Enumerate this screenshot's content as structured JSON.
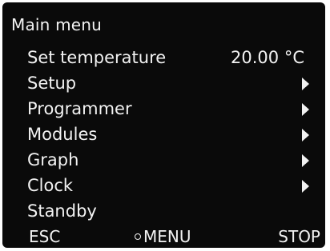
{
  "title": "Main menu",
  "menu": {
    "items": [
      {
        "label": "Set temperature",
        "value": "20.00 °C",
        "has_submenu": false
      },
      {
        "label": "Setup",
        "value": "",
        "has_submenu": true
      },
      {
        "label": "Programmer",
        "value": "",
        "has_submenu": true
      },
      {
        "label": "Modules",
        "value": "",
        "has_submenu": true
      },
      {
        "label": "Graph",
        "value": "",
        "has_submenu": true
      },
      {
        "label": "Clock",
        "value": "",
        "has_submenu": true
      },
      {
        "label": "Standby",
        "value": "",
        "has_submenu": false
      }
    ]
  },
  "softkeys": {
    "esc": "ESC",
    "menu": "MENU",
    "stop": "STOP"
  },
  "colors": {
    "background": "#0a0a0a",
    "foreground": "#f2f2f2"
  }
}
